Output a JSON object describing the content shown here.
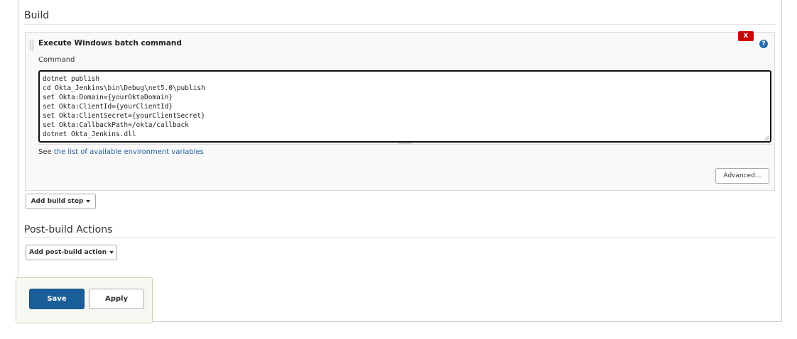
{
  "build": {
    "section_title": "Build",
    "step": {
      "title": "Execute Windows batch command",
      "delete_label": "X",
      "help_label": "?",
      "command_label": "Command",
      "command_value": "dotnet publish\ncd Okta_Jenkins\\bin\\Debug\\net5.0\\publish\nset Okta:Domain={yourOktaDomain}\nset Okta:ClientId={yourClientId}\nset Okta:ClientSecret={yourClientSecret}\nset Okta:CallbackPath=/okta/callback\ndotnet Okta_Jenkins.dll",
      "env_help_prefix": "See",
      "env_help_link": "the list of available environment variables",
      "advanced_label": "Advanced..."
    },
    "add_step_label": "Add build step"
  },
  "post_build": {
    "section_title": "Post-build Actions",
    "add_action_label": "Add post-build action"
  },
  "actions": {
    "save_label": "Save",
    "apply_label": "Apply"
  },
  "colors": {
    "primary_button": "#1a5e99",
    "delete_button": "#cc0000",
    "link": "#1f5c99"
  }
}
